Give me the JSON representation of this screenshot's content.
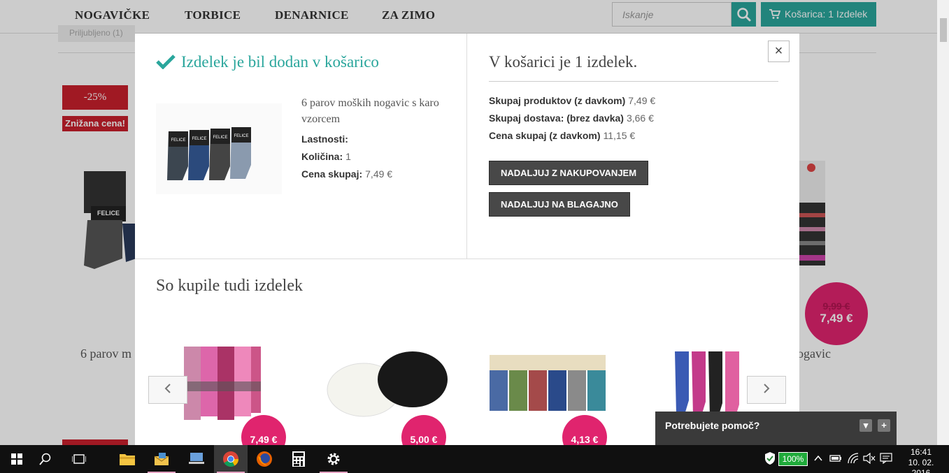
{
  "nav": {
    "items": [
      "NOGAVIČKE",
      "TORBICE",
      "DENARNICE",
      "ZA ZIMO"
    ],
    "search_placeholder": "Iskanje",
    "cart_label": "Košarica: 1 Izdelek"
  },
  "background": {
    "discount_badge": "-25%",
    "sale_badge": "Znižana cena!",
    "product_text_left": "6 parov m",
    "product_text_right": "ogavic",
    "old_price": "9,99 €",
    "new_price": "7,49 €",
    "filter_chip": "Priljubljeno (1)"
  },
  "modal": {
    "added_title": "Izdelek je bil dodan v košarico",
    "product_name": "6 parov moških nogavic s karo vzorcem",
    "image_label": "FELICE",
    "properties_label": "Lastnosti:",
    "quantity_label": "Količina:",
    "quantity_value": "1",
    "total_label": "Cena skupaj:",
    "total_value": "7,49 €",
    "cart_count": "V košarici je 1 izdelek.",
    "products_total_label": "Skupaj produktov (z davkom)",
    "products_total_value": "7,49 €",
    "shipping_label": "Skupaj dostava: (brez davka)",
    "shipping_value": "3,66 €",
    "grand_total_label": "Cena skupaj (z davkom)",
    "grand_total_value": "11,15 €",
    "continue_shopping": "NADALJUJ Z NAKUPOVANJEM",
    "checkout": "NADALJUJ NA BLAGAJNO",
    "close": "×",
    "also_bought_title": "So kupile tudi izdelek",
    "related": [
      {
        "price": "7,49 €"
      },
      {
        "price": "5,00 €"
      },
      {
        "price": "4,13 €"
      },
      {
        "price": ""
      }
    ]
  },
  "help_widget": {
    "label": "Potrebujete pomoč?"
  },
  "taskbar": {
    "battery": "100%",
    "time": "16:41",
    "date": "10. 02. 2016"
  },
  "colors": {
    "accent": "#2aa69c",
    "sale_red": "#c9202c",
    "price_pink": "#e0246e"
  }
}
